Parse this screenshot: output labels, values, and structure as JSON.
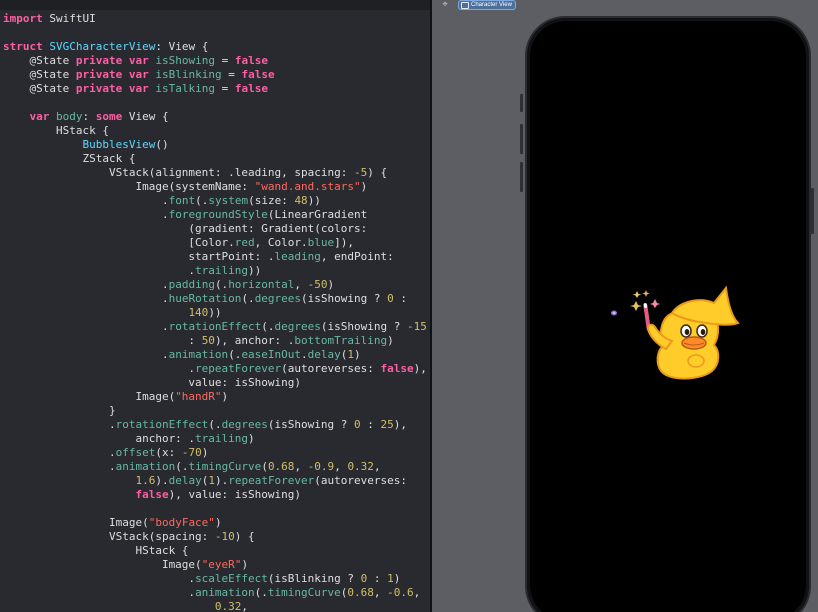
{
  "editor": {
    "lines": [
      [
        {
          "t": "import",
          "c": "kw"
        },
        {
          "t": " SwiftUI",
          "c": "pl"
        }
      ],
      [],
      [
        {
          "t": "struct",
          "c": "kw"
        },
        {
          "t": " ",
          "c": "pl"
        },
        {
          "t": "SVGCharacterView",
          "c": "ty"
        },
        {
          "t": ": View {",
          "c": "pl"
        }
      ],
      [
        {
          "t": "    @State ",
          "c": "pl"
        },
        {
          "t": "private",
          "c": "kw"
        },
        {
          "t": " ",
          "c": "pl"
        },
        {
          "t": "var",
          "c": "kw"
        },
        {
          "t": " ",
          "c": "pl"
        },
        {
          "t": "isShowing",
          "c": "fn"
        },
        {
          "t": " = ",
          "c": "pl"
        },
        {
          "t": "false",
          "c": "kw"
        }
      ],
      [
        {
          "t": "    @State ",
          "c": "pl"
        },
        {
          "t": "private",
          "c": "kw"
        },
        {
          "t": " ",
          "c": "pl"
        },
        {
          "t": "var",
          "c": "kw"
        },
        {
          "t": " ",
          "c": "pl"
        },
        {
          "t": "isBlinking",
          "c": "fn"
        },
        {
          "t": " = ",
          "c": "pl"
        },
        {
          "t": "false",
          "c": "kw"
        }
      ],
      [
        {
          "t": "    @State ",
          "c": "pl"
        },
        {
          "t": "private",
          "c": "kw"
        },
        {
          "t": " ",
          "c": "pl"
        },
        {
          "t": "var",
          "c": "kw"
        },
        {
          "t": " ",
          "c": "pl"
        },
        {
          "t": "isTalking",
          "c": "fn"
        },
        {
          "t": " = ",
          "c": "pl"
        },
        {
          "t": "false",
          "c": "kw"
        }
      ],
      [],
      [
        {
          "t": "    ",
          "c": "pl"
        },
        {
          "t": "var",
          "c": "kw"
        },
        {
          "t": " ",
          "c": "pl"
        },
        {
          "t": "body",
          "c": "fn"
        },
        {
          "t": ": ",
          "c": "pl"
        },
        {
          "t": "some",
          "c": "kw"
        },
        {
          "t": " View {",
          "c": "pl"
        }
      ],
      [
        {
          "t": "        HStack {",
          "c": "pl"
        }
      ],
      [
        {
          "t": "            ",
          "c": "pl"
        },
        {
          "t": "BubblesView",
          "c": "ty"
        },
        {
          "t": "()",
          "c": "pl"
        }
      ],
      [
        {
          "t": "            ZStack {",
          "c": "pl"
        }
      ],
      [
        {
          "t": "                VStack(alignment: .leading, spacing: ",
          "c": "pl"
        },
        {
          "t": "-5",
          "c": "nu"
        },
        {
          "t": ") {",
          "c": "pl"
        }
      ],
      [
        {
          "t": "                    Image(systemName: ",
          "c": "pl"
        },
        {
          "t": "\"wand.and.stars\"",
          "c": "st"
        },
        {
          "t": ")",
          "c": "pl"
        }
      ],
      [
        {
          "t": "                        .",
          "c": "pl"
        },
        {
          "t": "font",
          "c": "fn"
        },
        {
          "t": "(.",
          "c": "pl"
        },
        {
          "t": "system",
          "c": "fn"
        },
        {
          "t": "(size: ",
          "c": "pl"
        },
        {
          "t": "48",
          "c": "nu"
        },
        {
          "t": "))",
          "c": "pl"
        }
      ],
      [
        {
          "t": "                        .",
          "c": "pl"
        },
        {
          "t": "foregroundStyle",
          "c": "fn"
        },
        {
          "t": "(LinearGradient",
          "c": "pl"
        }
      ],
      [
        {
          "t": "                            (gradient: Gradient(colors:",
          "c": "pl"
        }
      ],
      [
        {
          "t": "                            [Color.",
          "c": "pl"
        },
        {
          "t": "red",
          "c": "fn"
        },
        {
          "t": ", Color.",
          "c": "pl"
        },
        {
          "t": "blue",
          "c": "fn"
        },
        {
          "t": "]),",
          "c": "pl"
        }
      ],
      [
        {
          "t": "                            startPoint: .",
          "c": "pl"
        },
        {
          "t": "leading",
          "c": "fn"
        },
        {
          "t": ", endPoint:",
          "c": "pl"
        }
      ],
      [
        {
          "t": "                            .",
          "c": "pl"
        },
        {
          "t": "trailing",
          "c": "fn"
        },
        {
          "t": "))",
          "c": "pl"
        }
      ],
      [
        {
          "t": "                        .",
          "c": "pl"
        },
        {
          "t": "padding",
          "c": "fn"
        },
        {
          "t": "(.",
          "c": "pl"
        },
        {
          "t": "horizontal",
          "c": "fn"
        },
        {
          "t": ", ",
          "c": "pl"
        },
        {
          "t": "-50",
          "c": "nu"
        },
        {
          "t": ")",
          "c": "pl"
        }
      ],
      [
        {
          "t": "                        .",
          "c": "pl"
        },
        {
          "t": "hueRotation",
          "c": "fn"
        },
        {
          "t": "(.",
          "c": "pl"
        },
        {
          "t": "degrees",
          "c": "fn"
        },
        {
          "t": "(isShowing ? ",
          "c": "pl"
        },
        {
          "t": "0",
          "c": "nu"
        },
        {
          "t": " :",
          "c": "pl"
        }
      ],
      [
        {
          "t": "                            ",
          "c": "pl"
        },
        {
          "t": "140",
          "c": "nu"
        },
        {
          "t": "))",
          "c": "pl"
        }
      ],
      [
        {
          "t": "                        .",
          "c": "pl"
        },
        {
          "t": "rotationEffect",
          "c": "fn"
        },
        {
          "t": "(.",
          "c": "pl"
        },
        {
          "t": "degrees",
          "c": "fn"
        },
        {
          "t": "(isShowing ? ",
          "c": "pl"
        },
        {
          "t": "-15",
          "c": "nu"
        }
      ],
      [
        {
          "t": "                            : ",
          "c": "pl"
        },
        {
          "t": "50",
          "c": "nu"
        },
        {
          "t": "), anchor: .",
          "c": "pl"
        },
        {
          "t": "bottomTrailing",
          "c": "fn"
        },
        {
          "t": ")",
          "c": "pl"
        }
      ],
      [
        {
          "t": "                        .",
          "c": "pl"
        },
        {
          "t": "animation",
          "c": "fn"
        },
        {
          "t": "(.",
          "c": "pl"
        },
        {
          "t": "easeInOut",
          "c": "fn"
        },
        {
          "t": ".",
          "c": "pl"
        },
        {
          "t": "delay",
          "c": "fn"
        },
        {
          "t": "(",
          "c": "pl"
        },
        {
          "t": "1",
          "c": "nu"
        },
        {
          "t": ")",
          "c": "pl"
        }
      ],
      [
        {
          "t": "                            .",
          "c": "pl"
        },
        {
          "t": "repeatForever",
          "c": "fn"
        },
        {
          "t": "(autoreverses: ",
          "c": "pl"
        },
        {
          "t": "false",
          "c": "kw"
        },
        {
          "t": "),",
          "c": "pl"
        }
      ],
      [
        {
          "t": "                            value: isShowing)",
          "c": "pl"
        }
      ],
      [
        {
          "t": "                    Image(",
          "c": "pl"
        },
        {
          "t": "\"handR\"",
          "c": "st"
        },
        {
          "t": ")",
          "c": "pl"
        }
      ],
      [
        {
          "t": "                }",
          "c": "pl"
        }
      ],
      [
        {
          "t": "                .",
          "c": "pl"
        },
        {
          "t": "rotationEffect",
          "c": "fn"
        },
        {
          "t": "(.",
          "c": "pl"
        },
        {
          "t": "degrees",
          "c": "fn"
        },
        {
          "t": "(isShowing ? ",
          "c": "pl"
        },
        {
          "t": "0",
          "c": "nu"
        },
        {
          "t": " : ",
          "c": "pl"
        },
        {
          "t": "25",
          "c": "nu"
        },
        {
          "t": "),",
          "c": "pl"
        }
      ],
      [
        {
          "t": "                    anchor: .",
          "c": "pl"
        },
        {
          "t": "trailing",
          "c": "fn"
        },
        {
          "t": ")",
          "c": "pl"
        }
      ],
      [
        {
          "t": "                .",
          "c": "pl"
        },
        {
          "t": "offset",
          "c": "fn"
        },
        {
          "t": "(x: ",
          "c": "pl"
        },
        {
          "t": "-70",
          "c": "nu"
        },
        {
          "t": ")",
          "c": "pl"
        }
      ],
      [
        {
          "t": "                .",
          "c": "pl"
        },
        {
          "t": "animation",
          "c": "fn"
        },
        {
          "t": "(.",
          "c": "pl"
        },
        {
          "t": "timingCurve",
          "c": "fn"
        },
        {
          "t": "(",
          "c": "pl"
        },
        {
          "t": "0.68",
          "c": "nu"
        },
        {
          "t": ", ",
          "c": "pl"
        },
        {
          "t": "-0.9",
          "c": "nu"
        },
        {
          "t": ", ",
          "c": "pl"
        },
        {
          "t": "0.32",
          "c": "nu"
        },
        {
          "t": ",",
          "c": "pl"
        }
      ],
      [
        {
          "t": "                    ",
          "c": "pl"
        },
        {
          "t": "1.6",
          "c": "nu"
        },
        {
          "t": ").",
          "c": "pl"
        },
        {
          "t": "delay",
          "c": "fn"
        },
        {
          "t": "(",
          "c": "pl"
        },
        {
          "t": "1",
          "c": "nu"
        },
        {
          "t": ").",
          "c": "pl"
        },
        {
          "t": "repeatForever",
          "c": "fn"
        },
        {
          "t": "(autoreverses:",
          "c": "pl"
        }
      ],
      [
        {
          "t": "                    ",
          "c": "pl"
        },
        {
          "t": "false",
          "c": "kw"
        },
        {
          "t": "), value: isShowing)",
          "c": "pl"
        }
      ],
      [],
      [
        {
          "t": "                Image(",
          "c": "pl"
        },
        {
          "t": "\"bodyFace\"",
          "c": "st"
        },
        {
          "t": ")",
          "c": "pl"
        }
      ],
      [
        {
          "t": "                VStack(spacing: ",
          "c": "pl"
        },
        {
          "t": "-10",
          "c": "nu"
        },
        {
          "t": ") {",
          "c": "pl"
        }
      ],
      [
        {
          "t": "                    HStack {",
          "c": "pl"
        }
      ],
      [
        {
          "t": "                        Image(",
          "c": "pl"
        },
        {
          "t": "\"eyeR\"",
          "c": "st"
        },
        {
          "t": ")",
          "c": "pl"
        }
      ],
      [
        {
          "t": "                            .",
          "c": "pl"
        },
        {
          "t": "scaleEffect",
          "c": "fn"
        },
        {
          "t": "(isBlinking ? ",
          "c": "pl"
        },
        {
          "t": "0",
          "c": "nu"
        },
        {
          "t": " : ",
          "c": "pl"
        },
        {
          "t": "1",
          "c": "nu"
        },
        {
          "t": ")",
          "c": "pl"
        }
      ],
      [
        {
          "t": "                            .",
          "c": "pl"
        },
        {
          "t": "animation",
          "c": "fn"
        },
        {
          "t": "(.",
          "c": "pl"
        },
        {
          "t": "timingCurve",
          "c": "fn"
        },
        {
          "t": "(",
          "c": "pl"
        },
        {
          "t": "0.68",
          "c": "nu"
        },
        {
          "t": ", ",
          "c": "pl"
        },
        {
          "t": "-0.6",
          "c": "nu"
        },
        {
          "t": ",",
          "c": "pl"
        }
      ],
      [
        {
          "t": "                                ",
          "c": "pl"
        },
        {
          "t": "0.32",
          "c": "nu"
        },
        {
          "t": ",",
          "c": "pl"
        }
      ]
    ]
  },
  "preview": {
    "pin_icon": "pin-icon",
    "pin_glyph": "⌖",
    "tab_label": "Character View",
    "tab_icon": "preview-icon",
    "character": "duck-wizard-character"
  },
  "colors": {
    "editor_bg": "#292a30",
    "keyword": "#fc5fa3",
    "type": "#5dd8ff",
    "identifier": "#67b7a4",
    "string": "#fc6a5d",
    "number": "#d0bf69",
    "plain": "#dfdfe0",
    "preview_bg": "#5c5e63",
    "screen_bg": "#000000",
    "duck_body": "#ffc926",
    "duck_beak": "#ff8a2a"
  }
}
